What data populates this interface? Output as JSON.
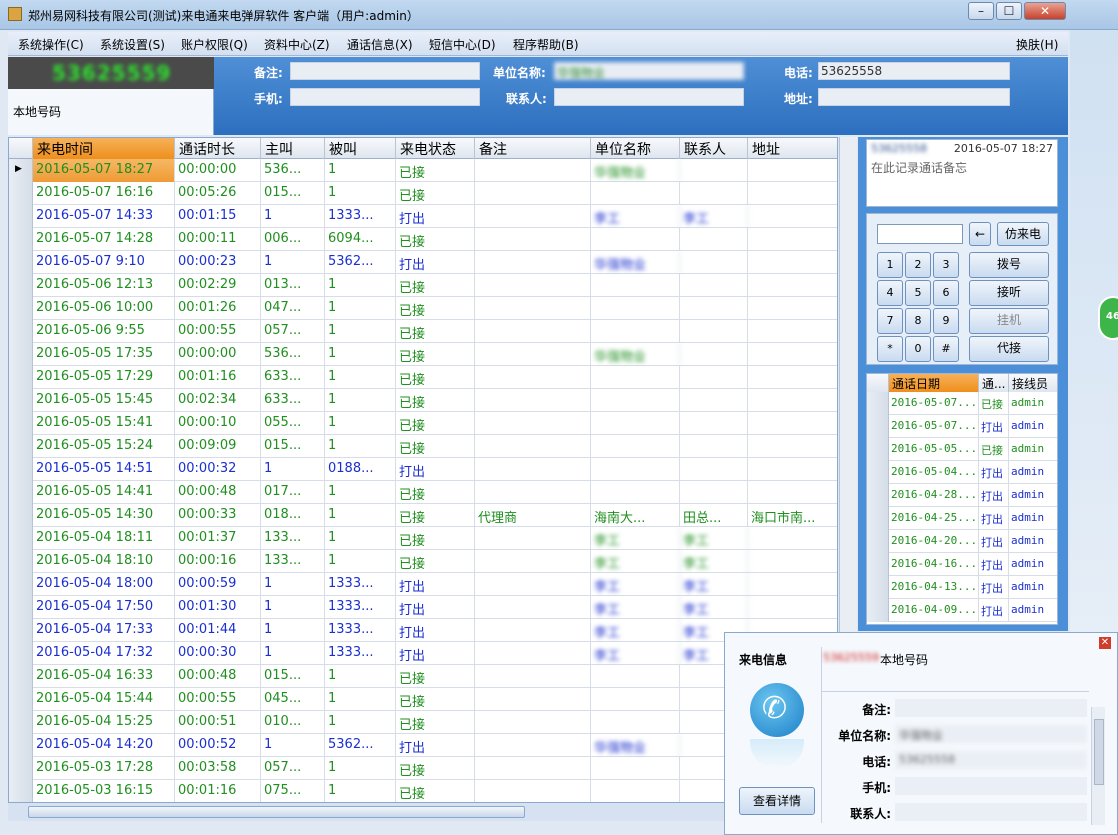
{
  "window": {
    "title": "郑州易网科技有限公司(测试)来电通来电弹屏软件 客户端（用户:admin）",
    "min": "–",
    "max": "☐",
    "close": "✕"
  },
  "menu": [
    "系统操作(C)",
    "系统设置(S)",
    "账户权限(Q)",
    "资料中心(Z)",
    "通话信息(X)",
    "短信中心(D)",
    "程序帮助(B)"
  ],
  "skin": "换肤(H)",
  "caller": {
    "number": "53625559",
    "local_label": "本地号码"
  },
  "info": {
    "note_label": "备注:",
    "note": "",
    "company_label": "单位名称:",
    "company": "华强物业",
    "phone_label": "电话:",
    "phone": "53625558",
    "mobile_label": "手机:",
    "mobile": "",
    "contact_label": "联系人:",
    "contact": "",
    "address_label": "地址:",
    "address": ""
  },
  "grid": {
    "headers": [
      "来电时间",
      "通话时长",
      "主叫",
      "被叫",
      "来电状态",
      "备注",
      "单位名称",
      "联系人",
      "地址"
    ],
    "rows": [
      [
        "2016-05-07 18:27",
        "00:00:00",
        "536...",
        "1",
        "已接",
        "",
        "华强物业",
        "",
        ""
      ],
      [
        "2016-05-07 16:16",
        "00:05:26",
        "015...",
        "1",
        "已接",
        "",
        "",
        "",
        ""
      ],
      [
        "2016-05-07 14:33",
        "00:01:15",
        "1",
        "1333...",
        "打出",
        "",
        "李工",
        "李工",
        ""
      ],
      [
        "2016-05-07 14:28",
        "00:00:11",
        "006...",
        "6094...",
        "已接",
        "",
        "",
        "",
        ""
      ],
      [
        "2016-05-07 9:10",
        "00:00:23",
        "1",
        "5362...",
        "打出",
        "",
        "华强物业",
        "",
        ""
      ],
      [
        "2016-05-06 12:13",
        "00:02:29",
        "013...",
        "1",
        "已接",
        "",
        "",
        "",
        ""
      ],
      [
        "2016-05-06 10:00",
        "00:01:26",
        "047...",
        "1",
        "已接",
        "",
        "",
        "",
        ""
      ],
      [
        "2016-05-06 9:55",
        "00:00:55",
        "057...",
        "1",
        "已接",
        "",
        "",
        "",
        ""
      ],
      [
        "2016-05-05 17:35",
        "00:00:00",
        "536...",
        "1",
        "已接",
        "",
        "华强物业",
        "",
        ""
      ],
      [
        "2016-05-05 17:29",
        "00:01:16",
        "633...",
        "1",
        "已接",
        "",
        "",
        "",
        ""
      ],
      [
        "2016-05-05 15:45",
        "00:02:34",
        "633...",
        "1",
        "已接",
        "",
        "",
        "",
        ""
      ],
      [
        "2016-05-05 15:41",
        "00:00:10",
        "055...",
        "1",
        "已接",
        "",
        "",
        "",
        ""
      ],
      [
        "2016-05-05 15:24",
        "00:09:09",
        "015...",
        "1",
        "已接",
        "",
        "",
        "",
        ""
      ],
      [
        "2016-05-05 14:51",
        "00:00:32",
        "1",
        "0188...",
        "打出",
        "",
        "",
        "",
        ""
      ],
      [
        "2016-05-05 14:41",
        "00:00:48",
        "017...",
        "1",
        "已接",
        "",
        "",
        "",
        ""
      ],
      [
        "2016-05-05 14:30",
        "00:00:33",
        "018...",
        "1",
        "已接",
        "代理商",
        "海南大...",
        "田总...",
        "海口市南..."
      ],
      [
        "2016-05-04 18:11",
        "00:01:37",
        "133...",
        "1",
        "已接",
        "",
        "李工",
        "李工",
        ""
      ],
      [
        "2016-05-04 18:10",
        "00:00:16",
        "133...",
        "1",
        "已接",
        "",
        "李工",
        "李工",
        ""
      ],
      [
        "2016-05-04 18:00",
        "00:00:59",
        "1",
        "1333...",
        "打出",
        "",
        "李工",
        "李工",
        ""
      ],
      [
        "2016-05-04 17:50",
        "00:01:30",
        "1",
        "1333...",
        "打出",
        "",
        "李工",
        "李工",
        ""
      ],
      [
        "2016-05-04 17:33",
        "00:01:44",
        "1",
        "1333...",
        "打出",
        "",
        "李工",
        "李工",
        ""
      ],
      [
        "2016-05-04 17:32",
        "00:00:30",
        "1",
        "1333...",
        "打出",
        "",
        "李工",
        "李工",
        ""
      ],
      [
        "2016-05-04 16:33",
        "00:00:48",
        "015...",
        "1",
        "已接",
        "",
        "",
        "",
        ""
      ],
      [
        "2016-05-04 15:44",
        "00:00:55",
        "045...",
        "1",
        "已接",
        "",
        "",
        "",
        ""
      ],
      [
        "2016-05-04 15:25",
        "00:00:51",
        "010...",
        "1",
        "已接",
        "",
        "",
        "",
        ""
      ],
      [
        "2016-05-04 14:20",
        "00:00:52",
        "1",
        "5362...",
        "打出",
        "",
        "华强物业",
        "",
        ""
      ],
      [
        "2016-05-03 17:28",
        "00:03:58",
        "057...",
        "1",
        "已接",
        "",
        "",
        "",
        ""
      ],
      [
        "2016-05-03 16:15",
        "00:01:16",
        "075...",
        "1",
        "已接",
        "",
        "",
        "",
        ""
      ]
    ]
  },
  "memo": {
    "number": "53625558",
    "time": "2016-05-07  18:27",
    "placeholder": "在此记录通话备忘"
  },
  "dialpad": {
    "back": "←",
    "fake": "仿来电",
    "keys": [
      "1",
      "2",
      "3",
      "4",
      "5",
      "6",
      "7",
      "8",
      "9",
      "*",
      "0",
      "#"
    ],
    "dial": "拨号",
    "answer": "接听",
    "hangup": "挂机",
    "proxy": "代接"
  },
  "mini": {
    "headers": [
      "通话日期",
      "通...",
      "接线员"
    ],
    "rows": [
      [
        "2016-05-07...",
        "已接",
        "admin"
      ],
      [
        "2016-05-07...",
        "打出",
        "admin"
      ],
      [
        "2016-05-05...",
        "已接",
        "admin"
      ],
      [
        "2016-05-04...",
        "打出",
        "admin"
      ],
      [
        "2016-04-28...",
        "打出",
        "admin"
      ],
      [
        "2016-04-25...",
        "打出",
        "admin"
      ],
      [
        "2016-04-20...",
        "打出",
        "admin"
      ],
      [
        "2016-04-16...",
        "打出",
        "admin"
      ],
      [
        "2016-04-13...",
        "打出",
        "admin"
      ],
      [
        "2016-04-09...",
        "打出",
        "admin"
      ]
    ]
  },
  "popup": {
    "title": "来电信息",
    "number": "53625559",
    "local": "本地号码",
    "note_label": "备注:",
    "company_label": "单位名称:",
    "company": "华强物业",
    "phone_label": "电话:",
    "phone": "53625558",
    "mobile_label": "手机:",
    "contact_label": "联系人:",
    "detail": "查看详情",
    "close": "✕"
  },
  "badge": "46",
  "colors": {
    "accent": "#2d6fbf",
    "answered": "#1f8f1f",
    "outgoing": "#1b2fcf",
    "sorted_header": "#ef8f1c"
  }
}
